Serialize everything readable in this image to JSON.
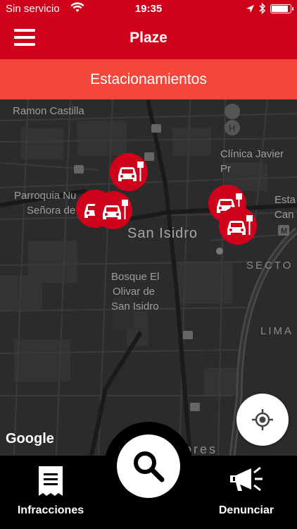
{
  "status_bar": {
    "carrier": "Sin servicio",
    "time": "19:35",
    "battery_level": 0.9
  },
  "header": {
    "title": "Plaze",
    "menu_icon": "hamburger-menu-icon"
  },
  "subheader": {
    "title": "Estacionamientos"
  },
  "map": {
    "labels": {
      "ramon_castilla": "Ramon Castilla",
      "clinica": "Clínica Javier Pr",
      "parroquia_1": "Parroquia Nu",
      "parroquia_2": "Señora de",
      "san_isidro": "San Isidro",
      "estac_1": "Esta",
      "estac_2": "Can",
      "sector": "SECTO",
      "bosque_1": "Bosque El",
      "bosque_2": "Olivar de",
      "bosque_3": "San Isidro",
      "lima": "LIMA",
      "flores": "ores",
      "metro": "M"
    },
    "attribution": "Google",
    "marker_icon": "parking-car-marker-icon",
    "marker_count": 5
  },
  "bottom_bar": {
    "left_label": "Infracciones",
    "left_icon": "receipt-icon",
    "center_icon": "search-icon",
    "right_label": "Denunciar",
    "right_icon": "megaphone-icon"
  },
  "colors": {
    "primary": "#d0021b",
    "secondary": "#f4473c",
    "map_bg": "#2b2b2b"
  }
}
